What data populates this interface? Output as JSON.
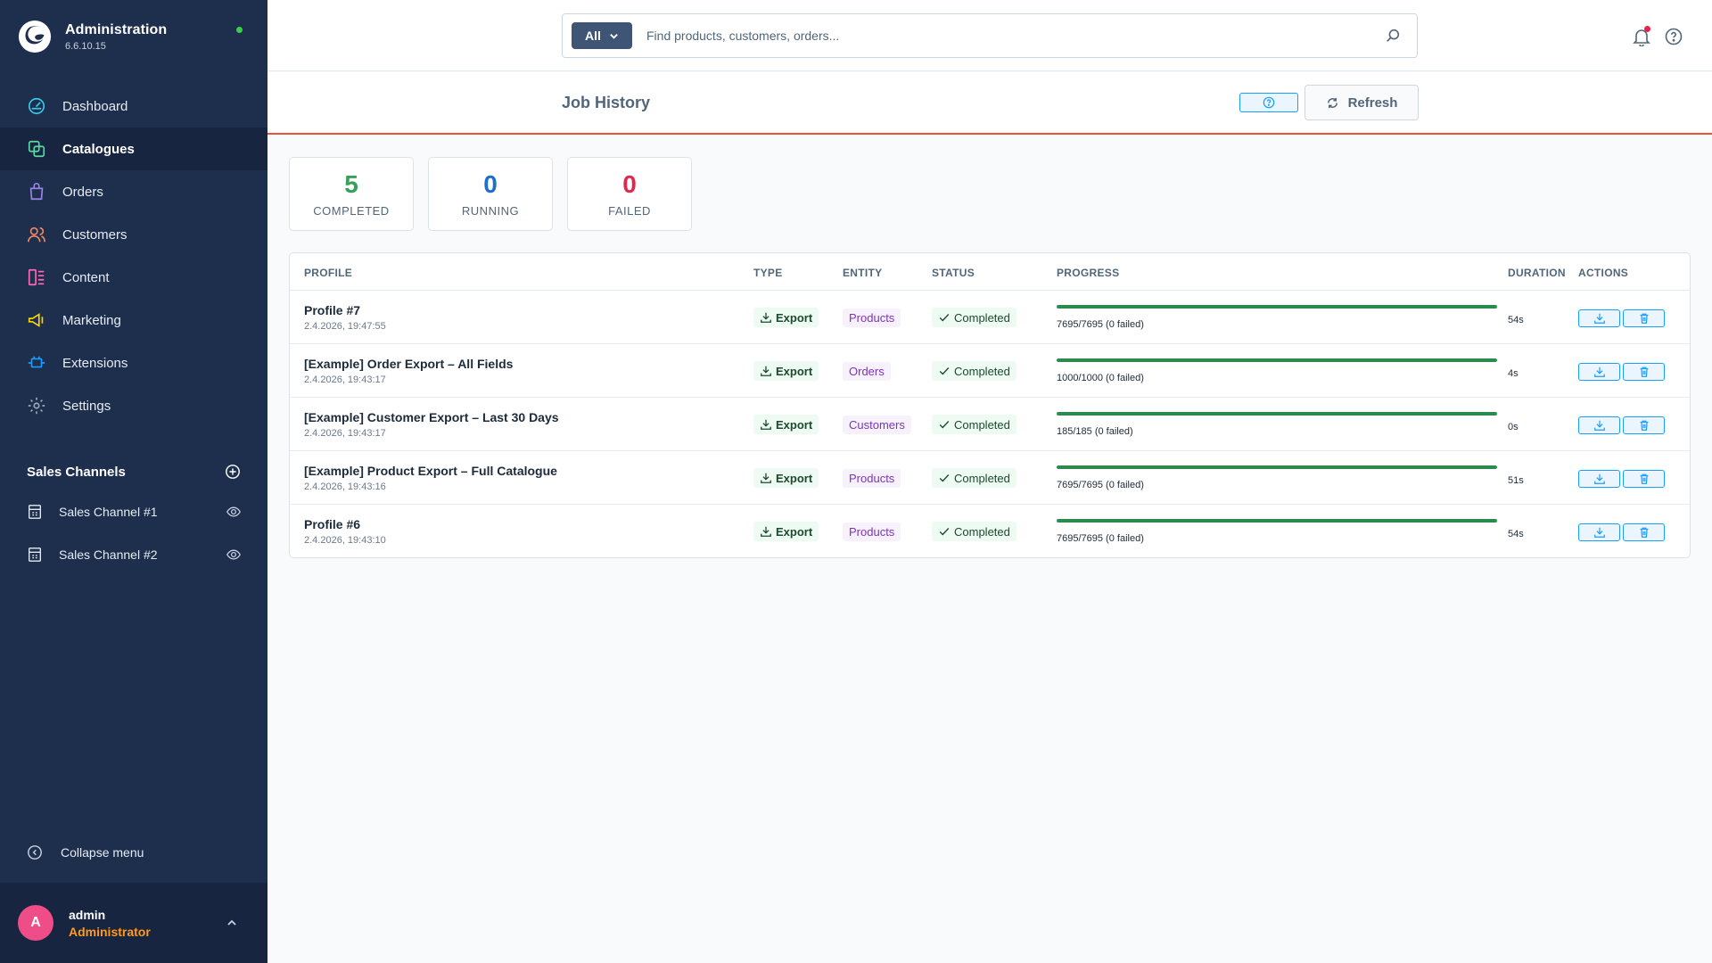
{
  "brand": {
    "title": "Administration",
    "version": "6.6.10.15",
    "status_color": "#37d046"
  },
  "nav": [
    {
      "label": "Dashboard",
      "icon": "dashboard-icon",
      "color": "#3ac7e8"
    },
    {
      "label": "Catalogues",
      "icon": "catalogues-icon",
      "color": "#57d9a3",
      "active": true
    },
    {
      "label": "Orders",
      "icon": "orders-icon",
      "color": "#9b84e8"
    },
    {
      "label": "Customers",
      "icon": "customers-icon",
      "color": "#f08962"
    },
    {
      "label": "Content",
      "icon": "content-icon",
      "color": "#ff68b4"
    },
    {
      "label": "Marketing",
      "icon": "marketing-icon",
      "color": "#ffd700"
    },
    {
      "label": "Extensions",
      "icon": "extensions-icon",
      "color": "#189eff"
    },
    {
      "label": "Settings",
      "icon": "settings-icon",
      "color": "#9aa8b5"
    }
  ],
  "sales_channels": {
    "title": "Sales Channels",
    "items": [
      {
        "label": "Sales Channel #1"
      },
      {
        "label": "Sales Channel #2"
      }
    ]
  },
  "collapse_label": "Collapse menu",
  "user": {
    "initial": "A",
    "name": "admin",
    "role": "Administrator"
  },
  "search": {
    "type_label": "All",
    "placeholder": "Find products, customers, orders..."
  },
  "page": {
    "title": "Job History",
    "refresh_label": "Refresh"
  },
  "stats": [
    {
      "value": "5",
      "label": "COMPLETED",
      "color": "#37a05a"
    },
    {
      "value": "0",
      "label": "RUNNING",
      "color": "#1d70c8"
    },
    {
      "value": "0",
      "label": "FAILED",
      "color": "#de294c"
    }
  ],
  "table": {
    "headers": {
      "profile": "PROFILE",
      "type": "TYPE",
      "entity": "ENTITY",
      "status": "STATUS",
      "progress": "PROGRESS",
      "duration": "DURATION",
      "actions": "ACTIONS"
    },
    "rows": [
      {
        "name": "Profile #7",
        "date": "2.4.2026, 19:47:55",
        "type": "Export",
        "entity": "Products",
        "status": "Completed",
        "progress": 1.0,
        "progress_text": "7695/7695 (0 failed)",
        "duration": "54s"
      },
      {
        "name": "[Example] Order Export – All Fields",
        "date": "2.4.2026, 19:43:17",
        "type": "Export",
        "entity": "Orders",
        "status": "Completed",
        "progress": 1.0,
        "progress_text": "1000/1000 (0 failed)",
        "duration": "4s"
      },
      {
        "name": "[Example] Customer Export – Last 30 Days",
        "date": "2.4.2026, 19:43:17",
        "type": "Export",
        "entity": "Customers",
        "status": "Completed",
        "progress": 1.0,
        "progress_text": "185/185 (0 failed)",
        "duration": "0s"
      },
      {
        "name": "[Example] Product Export – Full Catalogue",
        "date": "2.4.2026, 19:43:16",
        "type": "Export",
        "entity": "Products",
        "status": "Completed",
        "progress": 1.0,
        "progress_text": "7695/7695 (0 failed)",
        "duration": "51s"
      },
      {
        "name": "Profile #6",
        "date": "2.4.2026, 19:43:10",
        "type": "Export",
        "entity": "Products",
        "status": "Completed",
        "progress": 1.0,
        "progress_text": "7695/7695 (0 failed)",
        "duration": "54s"
      }
    ]
  },
  "colors": {
    "sidebar_bg": "#1e2f4d",
    "accent_line": "#e9523a",
    "progress_fill": "#2b8a4e",
    "action_border": "#189eff"
  }
}
